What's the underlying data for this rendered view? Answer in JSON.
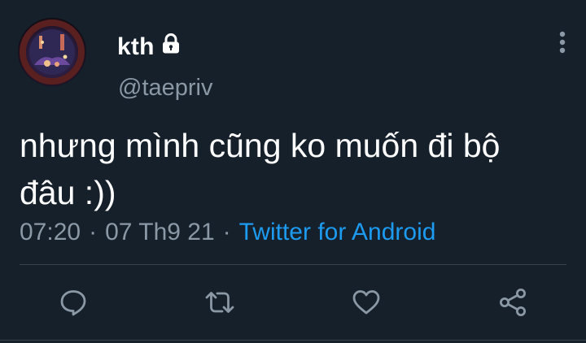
{
  "user": {
    "display_name": "kth",
    "handle": "@taepriv",
    "protected_icon": "lock-icon",
    "avatar_icon": "avatar"
  },
  "tweet": {
    "text": "nhưng mình cũng ko muốn đi bộ đâu :))",
    "time": "07:20",
    "date": "07 Th9 21",
    "separator": "·",
    "source": "Twitter for Android"
  },
  "actions": [
    {
      "name": "reply",
      "icon": "reply-icon"
    },
    {
      "name": "retweet",
      "icon": "retweet-icon"
    },
    {
      "name": "like",
      "icon": "heart-icon"
    },
    {
      "name": "share",
      "icon": "share-icon"
    }
  ],
  "menu": {
    "icon": "more-vertical-icon"
  },
  "colors": {
    "background": "#15202b",
    "primary_text": "#ffffff",
    "secondary_text": "#8b98a5",
    "link": "#1d9bf0",
    "divider": "#38444d"
  }
}
